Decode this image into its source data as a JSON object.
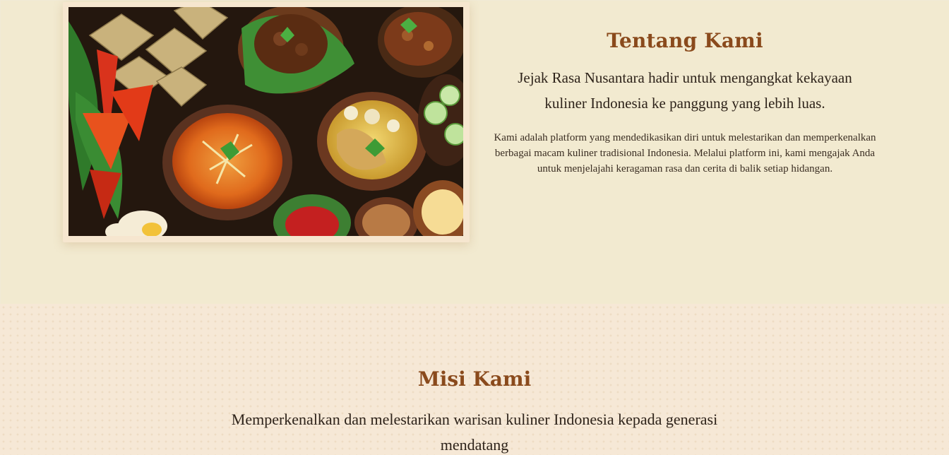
{
  "about": {
    "image_alt": "Aneka hidangan kuliner Indonesia",
    "title": "Tentang Kami",
    "lead": "Jejak Rasa Nusantara hadir untuk mengangkat kekayaan kuliner Indonesia ke panggung yang lebih luas.",
    "body": "Kami adalah platform yang mendedikasikan diri untuk melestarikan dan memperkenalkan berbagai macam kuliner tradisional Indonesia. Melalui platform ini, kami mengajak Anda untuk menjelajahi keragaman rasa dan cerita di balik setiap hidangan."
  },
  "mission": {
    "title": "Misi Kami",
    "text": "Memperkenalkan dan melestarikan warisan kuliner Indonesia kepada generasi mendatang"
  },
  "colors": {
    "heading": "#8a4a1c",
    "about_bg": "#fff9e3",
    "mission_bg": "#f6e8d6"
  }
}
